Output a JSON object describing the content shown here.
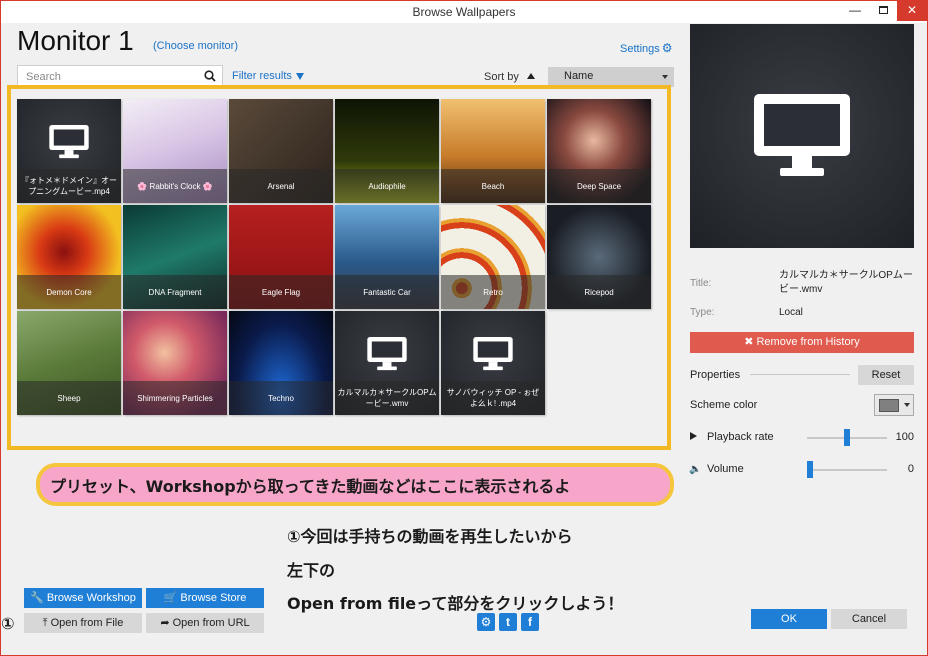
{
  "window": {
    "title": "Browse Wallpapers"
  },
  "header": {
    "title": "Monitor 1",
    "choose_monitor": "(Choose monitor)",
    "settings": "Settings"
  },
  "toolbar": {
    "search_placeholder": "Search",
    "filter": "Filter results",
    "sort_by": "Sort by",
    "sort_value": "Name"
  },
  "wallpapers": [
    {
      "title": "『ォトメ＊ドメイン』オープニングムービー.mp4",
      "kind": "video"
    },
    {
      "title": "🌸 Rabbit's Clock 🌸",
      "kind": "image"
    },
    {
      "title": "Arsenal",
      "kind": "image"
    },
    {
      "title": "Audiophile",
      "kind": "image"
    },
    {
      "title": "Beach",
      "kind": "image"
    },
    {
      "title": "Deep Space",
      "kind": "image"
    },
    {
      "title": "Demon Core",
      "kind": "image"
    },
    {
      "title": "DNA Fragment",
      "kind": "image"
    },
    {
      "title": "Eagle Flag",
      "kind": "image"
    },
    {
      "title": "Fantastic Car",
      "kind": "image"
    },
    {
      "title": "Retro",
      "kind": "image"
    },
    {
      "title": "Ricepod",
      "kind": "image"
    },
    {
      "title": "Sheep",
      "kind": "image"
    },
    {
      "title": "Shimmering Particles",
      "kind": "image"
    },
    {
      "title": "Techno",
      "kind": "image"
    },
    {
      "title": "カルマルカ＊サークルOPムービー.wmv",
      "kind": "video",
      "selected": true
    },
    {
      "title": "サノバウィッチ OP - ぉぜよ么ｋ! .mp4",
      "kind": "video"
    }
  ],
  "details": {
    "title_label": "Title:",
    "title_value": "カルマルカ＊サークルOPムービー.wmv",
    "type_label": "Type:",
    "type_value": "Local",
    "remove_button": "✖ Remove from History",
    "properties_label": "Properties",
    "reset_button": "Reset",
    "scheme_color_label": "Scheme color",
    "scheme_color": "#808080",
    "playback_label": "Playback rate",
    "playback_value": "100",
    "playback_level": 0.5,
    "volume_label": "Volume",
    "volume_value": "0",
    "volume_level": 0
  },
  "annotations": {
    "banner": "プリセット、Workshopから取ってきた動画などはここに表示されるよ",
    "line1": "①今回は手持ちの動画を再生したいから",
    "line2": "左下の",
    "line3": "Open from fileって部分をクリックしよう！",
    "marker": "①"
  },
  "footer": {
    "browse_workshop": "Browse Workshop",
    "browse_store": "Browse Store",
    "open_file": "Open from File",
    "open_url": "Open from URL",
    "ok": "OK",
    "cancel": "Cancel"
  },
  "colors": {
    "accent": "#1f7fd6",
    "danger": "#e05a4e",
    "highlight_frame": "#f2b924",
    "banner_bg": "#f7a6c9"
  }
}
